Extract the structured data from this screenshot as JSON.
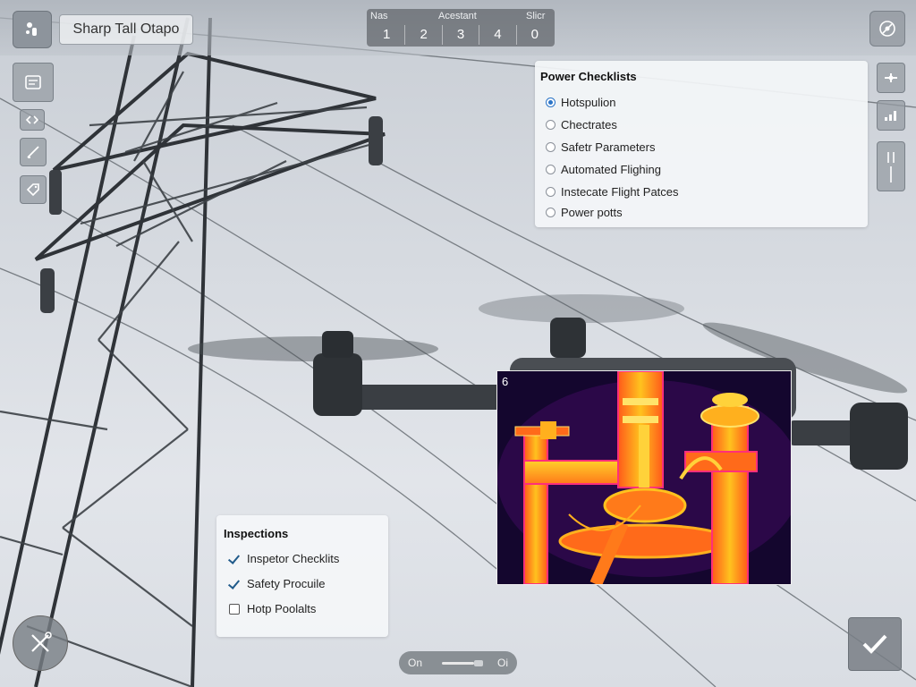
{
  "header": {
    "title": "Sharp Tall Otapo",
    "counter": {
      "labels": [
        "Nas",
        "Acestant",
        "Slicr"
      ],
      "values": [
        "1",
        "2",
        "3",
        "4",
        "0"
      ]
    }
  },
  "power_checklists": {
    "title": "Power Checklists",
    "options": [
      {
        "label": "Hotspulion",
        "selected": true
      },
      {
        "label": "Chectrates",
        "selected": false
      },
      {
        "label": "Safetr Parameters",
        "selected": false
      },
      {
        "label": "Automated Flighing",
        "selected": false
      },
      {
        "label": "Instecate Flight Patces",
        "selected": false
      },
      {
        "label": "Power potts",
        "selected": false
      }
    ]
  },
  "inspections": {
    "title": "Inspections",
    "items": [
      {
        "label": "Inspetor Checklits",
        "checked": true
      },
      {
        "label": "Safety Procuile",
        "checked": true
      },
      {
        "label": "Hotp Poolalts",
        "checked": false
      }
    ]
  },
  "thermal": {
    "label": "6"
  },
  "toggle": {
    "on_label": "On",
    "off_label": "Oi"
  },
  "colors": {
    "accent": "#2b74c7",
    "check": "#1f5a8a",
    "thermal_hot": "#ffd23a",
    "thermal_mid": "#ff6a1a",
    "thermal_cool": "#c2187a",
    "thermal_bg": "#14062e"
  }
}
